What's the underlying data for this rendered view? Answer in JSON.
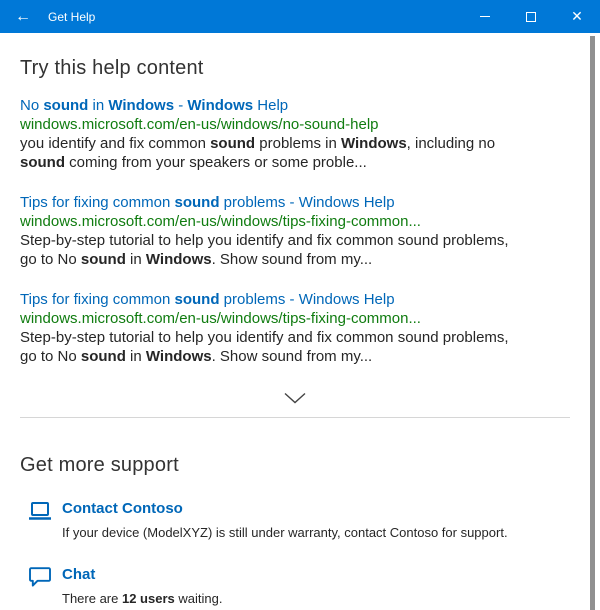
{
  "titlebar": {
    "title": "Get Help",
    "back_glyph": "←",
    "close_glyph": "✕"
  },
  "colors": {
    "titlebar_bg": "#0078d7",
    "link_blue": "#0067b8",
    "url_green": "#107c10",
    "text_dark": "#262626",
    "heading": "#333333",
    "divider": "#d6d6d6",
    "scrollbar": "#909090"
  },
  "help_section": {
    "heading": "Try this help content",
    "results": [
      {
        "title_segments": [
          {
            "t": "No ",
            "b": false
          },
          {
            "t": "sound",
            "b": true
          },
          {
            "t": " in ",
            "b": false
          },
          {
            "t": "Windows",
            "b": true
          },
          {
            "t": " - ",
            "b": false
          },
          {
            "t": "Windows",
            "b": true
          },
          {
            "t": " Help",
            "b": false
          }
        ],
        "url": "windows.microsoft.com/en-us/windows/no-sound-help",
        "snippet_line1_segments": [
          {
            "t": "you identify and fix common ",
            "b": false
          },
          {
            "t": "sound",
            "b": true
          },
          {
            "t": " problems in ",
            "b": false
          },
          {
            "t": "Windows",
            "b": true
          },
          {
            "t": ", including no",
            "b": false
          }
        ],
        "snippet_line2_segments": [
          {
            "t": "sound",
            "b": true
          },
          {
            "t": " coming from your speakers or some proble...",
            "b": false
          }
        ]
      },
      {
        "title_segments": [
          {
            "t": "Tips for fixing common ",
            "b": false
          },
          {
            "t": "sound",
            "b": true
          },
          {
            "t": " problems - Windows Help",
            "b": false
          }
        ],
        "url": "windows.microsoft.com/en-us/windows/tips-fixing-common...",
        "snippet_line1_segments": [
          {
            "t": "Step-by-step tutorial to help you identify and fix common sound problems,",
            "b": false
          }
        ],
        "snippet_line2_segments": [
          {
            "t": "go to No ",
            "b": false
          },
          {
            "t": "sound",
            "b": true
          },
          {
            "t": " in ",
            "b": false
          },
          {
            "t": "Windows",
            "b": true
          },
          {
            "t": ". Show sound from my...",
            "b": false
          }
        ]
      },
      {
        "title_segments": [
          {
            "t": "Tips for fixing common ",
            "b": false
          },
          {
            "t": "sound",
            "b": true
          },
          {
            "t": " problems - Windows Help",
            "b": false
          }
        ],
        "url": "windows.microsoft.com/en-us/windows/tips-fixing-common...",
        "snippet_line1_segments": [
          {
            "t": "Step-by-step tutorial to help you identify and fix common sound problems,",
            "b": false
          }
        ],
        "snippet_line2_segments": [
          {
            "t": "go to No ",
            "b": false
          },
          {
            "t": "sound",
            "b": true
          },
          {
            "t": " in ",
            "b": false
          },
          {
            "t": "Windows",
            "b": true
          },
          {
            "t": ". Show sound from my...",
            "b": false
          }
        ]
      }
    ]
  },
  "support_section": {
    "heading": "Get more support",
    "items": [
      {
        "icon": "laptop-icon",
        "label": "Contact Contoso",
        "description_segments": [
          {
            "t": "If your device (ModelXYZ) is still under warranty, contact Contoso for support.",
            "b": false
          }
        ]
      },
      {
        "icon": "chat-icon",
        "label": "Chat",
        "description_segments": [
          {
            "t": "There are ",
            "b": false
          },
          {
            "t": "12 users",
            "b": true
          },
          {
            "t": " waiting.",
            "b": false
          }
        ]
      }
    ]
  }
}
